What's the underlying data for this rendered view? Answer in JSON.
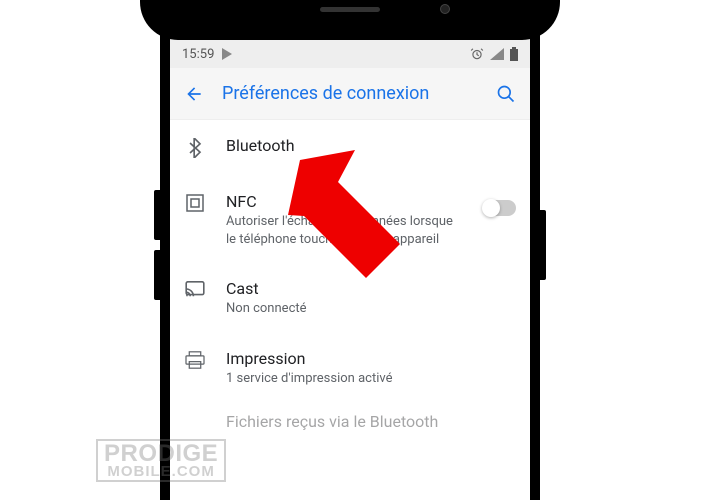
{
  "status": {
    "time": "15:59"
  },
  "header": {
    "title": "Préférences de connexion"
  },
  "settings": {
    "bluetooth": {
      "title": "Bluetooth"
    },
    "nfc": {
      "title": "NFC",
      "subtitle": "Autoriser l'échange de données lorsque le téléphone touche un autre appareil"
    },
    "cast": {
      "title": "Cast",
      "subtitle": "Non connecté"
    },
    "print": {
      "title": "Impression",
      "subtitle": "1 service d'impression activé"
    },
    "received": {
      "title": "Fichiers reçus via le Bluetooth"
    }
  },
  "watermark": {
    "line1": "PRODIGE",
    "line2": "MOBILE.COM"
  }
}
